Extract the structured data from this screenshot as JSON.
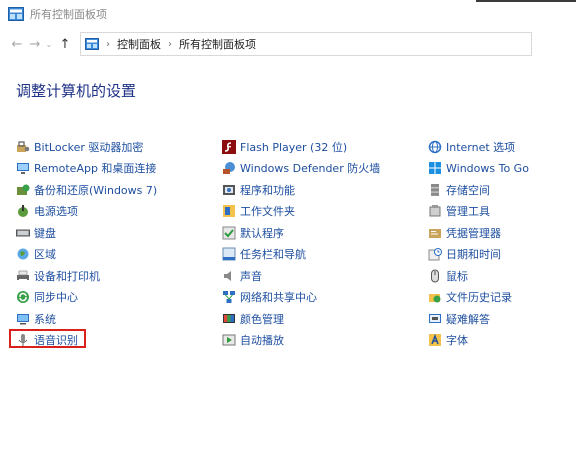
{
  "window": {
    "title": "所有控制面板项"
  },
  "nav": {
    "back_glyph": "←",
    "forward_glyph": "→",
    "dropdown_glyph": "⌄",
    "up_glyph": "↑"
  },
  "breadcrumb": {
    "items": [
      "控制面板",
      "所有控制面板项"
    ],
    "separator": "›"
  },
  "page": {
    "heading": "调整计算机的设置"
  },
  "columns": [
    [
      {
        "label": "BitLocker 驱动器加密",
        "icon": "bitlocker-icon"
      },
      {
        "label": "RemoteApp 和桌面连接",
        "icon": "remoteapp-icon"
      },
      {
        "label": "备份和还原(Windows 7)",
        "icon": "backup-icon"
      },
      {
        "label": "电源选项",
        "icon": "power-icon"
      },
      {
        "label": "键盘",
        "icon": "keyboard-icon"
      },
      {
        "label": "区域",
        "icon": "region-icon"
      },
      {
        "label": "设备和打印机",
        "icon": "devices-printers-icon"
      },
      {
        "label": "同步中心",
        "icon": "sync-center-icon"
      },
      {
        "label": "系统",
        "icon": "system-icon"
      },
      {
        "label": "语音识别",
        "icon": "speech-recognition-icon"
      }
    ],
    [
      {
        "label": "Flash Player (32 位)",
        "icon": "flash-player-icon"
      },
      {
        "label": "Windows Defender 防火墙",
        "icon": "firewall-icon"
      },
      {
        "label": "程序和功能",
        "icon": "programs-icon"
      },
      {
        "label": "工作文件夹",
        "icon": "work-folders-icon"
      },
      {
        "label": "默认程序",
        "icon": "default-programs-icon"
      },
      {
        "label": "任务栏和导航",
        "icon": "taskbar-icon"
      },
      {
        "label": "声音",
        "icon": "sound-icon"
      },
      {
        "label": "网络和共享中心",
        "icon": "network-icon"
      },
      {
        "label": "颜色管理",
        "icon": "color-management-icon"
      },
      {
        "label": "自动播放",
        "icon": "autoplay-icon"
      }
    ],
    [
      {
        "label": "Internet 选项",
        "icon": "internet-options-icon"
      },
      {
        "label": "Windows To Go",
        "icon": "windows-to-go-icon"
      },
      {
        "label": "存储空间",
        "icon": "storage-spaces-icon"
      },
      {
        "label": "管理工具",
        "icon": "admin-tools-icon"
      },
      {
        "label": "凭据管理器",
        "icon": "credential-manager-icon"
      },
      {
        "label": "日期和时间",
        "icon": "date-time-icon"
      },
      {
        "label": "鼠标",
        "icon": "mouse-icon"
      },
      {
        "label": "文件历史记录",
        "icon": "file-history-icon"
      },
      {
        "label": "疑难解答",
        "icon": "troubleshooting-icon"
      },
      {
        "label": "字体",
        "icon": "fonts-icon"
      }
    ]
  ],
  "highlight": {
    "color": "#d9201b",
    "target": "语音识别"
  },
  "colors": {
    "link": "#1e4fa0",
    "heading": "#1e3287",
    "muted": "#8a8a8a"
  }
}
